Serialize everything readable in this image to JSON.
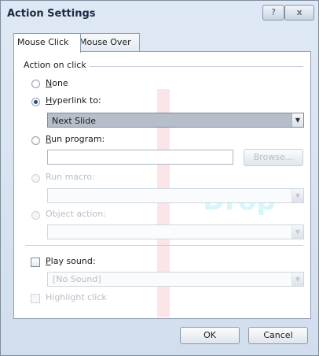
{
  "window": {
    "title": "Action Settings",
    "help_label": "?",
    "close_label": "x"
  },
  "tabs": [
    {
      "label": "Mouse Click",
      "active": true
    },
    {
      "label": "Mouse Over",
      "active": false
    }
  ],
  "action_group": {
    "label": "Action on click",
    "options": [
      {
        "label": "None",
        "accel": "N",
        "rest": "one",
        "selected": false,
        "enabled": true
      },
      {
        "label": "Hyperlink to:",
        "accel": "H",
        "rest": "yperlink to:",
        "selected": true,
        "enabled": true
      },
      {
        "label": "Run program:",
        "accel": "R",
        "rest": "un program:",
        "selected": false,
        "enabled": true
      },
      {
        "label": "Run macro:",
        "selected": false,
        "enabled": false
      },
      {
        "label": "Object action:",
        "selected": false,
        "enabled": false
      }
    ],
    "hyperlink_value": "Next Slide",
    "run_program_value": "",
    "browse_label": "Browse...",
    "macro_value": "",
    "object_action_value": ""
  },
  "sound": {
    "play_sound_label": "Play sound:",
    "accel": "P",
    "rest": "lay sound:",
    "checked": false,
    "sound_value": "[No Sound]",
    "highlight_label": "Highlight click",
    "highlight_checked": false
  },
  "footer": {
    "ok_label": "OK",
    "cancel_label": "Cancel"
  },
  "colors": {
    "title_bar": "#dfe9f5",
    "selected_combo": "#b6bfc9",
    "watermark_text": "#2bd1e6",
    "watermark_bar": "#e24a63"
  }
}
